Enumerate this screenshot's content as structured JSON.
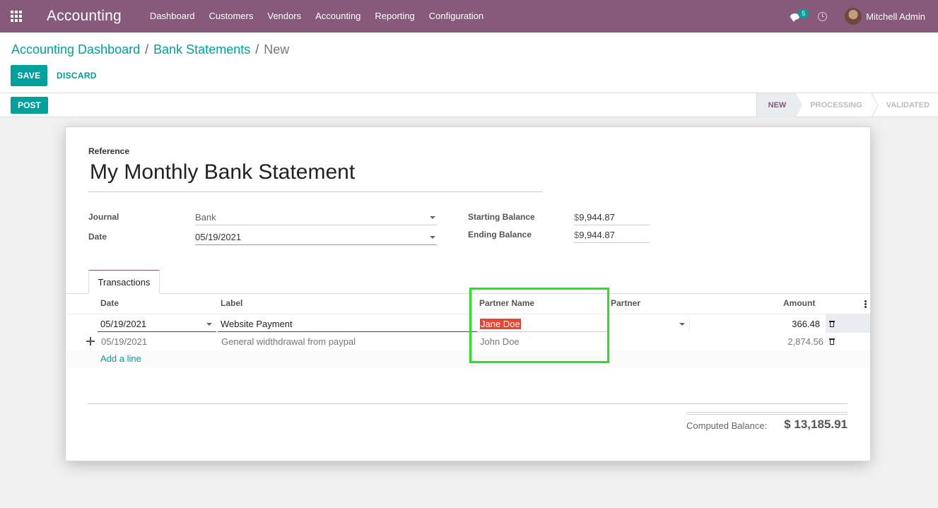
{
  "navbar": {
    "app_name": "Accounting",
    "menu": [
      "Dashboard",
      "Customers",
      "Vendors",
      "Accounting",
      "Reporting",
      "Configuration"
    ],
    "messages_count": "5",
    "user_name": "Mitchell Admin",
    "color": "#875a7b"
  },
  "breadcrumb": {
    "items": [
      "Accounting Dashboard",
      "Bank Statements"
    ],
    "current": "New",
    "separator": "/"
  },
  "buttons": {
    "save": "SAVE",
    "discard": "DISCARD",
    "post": "POST"
  },
  "status": {
    "stages": [
      "NEW",
      "PROCESSING",
      "VALIDATED"
    ],
    "current": "NEW"
  },
  "form": {
    "reference_label": "Reference",
    "reference_value": "My Monthly Bank Statement",
    "journal_label": "Journal",
    "journal_value": "Bank",
    "date_label": "Date",
    "date_value": "05/19/2021",
    "starting_balance_label": "Starting Balance",
    "starting_balance_currency": "$",
    "starting_balance_value": "9,944.87",
    "ending_balance_label": "Ending Balance",
    "ending_balance_currency": "$",
    "ending_balance_value": "9,944.87"
  },
  "tabs": [
    "Transactions"
  ],
  "transactions": {
    "columns": [
      "Date",
      "Label",
      "Partner Name",
      "Partner",
      "Amount"
    ],
    "rows": [
      {
        "date": "05/19/2021",
        "label": "Website Payment",
        "partner_name": "Jane Doe",
        "partner": "",
        "amount": "366.48"
      },
      {
        "date": "05/19/2021",
        "label": "General widthdrawal from paypal",
        "partner_name": "John Doe",
        "partner": "",
        "amount": "2,874.56"
      }
    ],
    "add_line": "Add a line"
  },
  "totals": {
    "computed_balance_label": "Computed Balance:",
    "computed_balance_value": "$ 13,185.91"
  },
  "colors": {
    "primary": "#00a09d",
    "brand": "#875a7b",
    "highlight_box": "#22e522",
    "selection": "#e8442e"
  }
}
